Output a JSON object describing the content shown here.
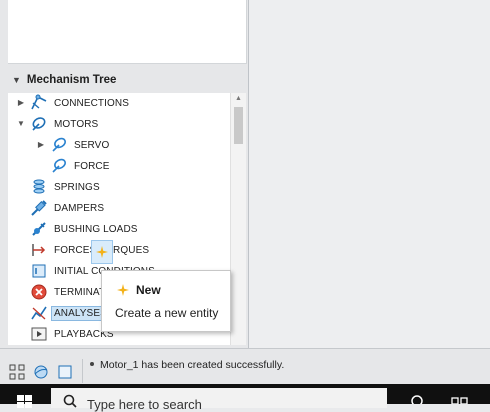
{
  "mechanism_tree": {
    "header": "Mechanism Tree",
    "items": [
      {
        "label": "CONNECTIONS",
        "expander": "collapsed",
        "icon": "connections-icon"
      },
      {
        "label": "MOTORS",
        "expander": "expanded",
        "icon": "motors-icon"
      },
      {
        "label": "SERVO",
        "expander": "collapsed",
        "icon": "servo-motor-icon"
      },
      {
        "label": "FORCE",
        "expander": "none",
        "icon": "force-motor-icon"
      },
      {
        "label": "SPRINGS",
        "expander": "none",
        "icon": "spring-icon"
      },
      {
        "label": "DAMPERS",
        "expander": "none",
        "icon": "damper-icon"
      },
      {
        "label": "BUSHING LOADS",
        "expander": "none",
        "icon": "bushing-load-icon"
      },
      {
        "label": "FORCES/TORQUES",
        "expander": "none",
        "icon": "force-torque-icon"
      },
      {
        "label": "INITIAL CONDITIONS",
        "expander": "none",
        "icon": "initial-conditions-icon"
      },
      {
        "label": "TERMINATION CONDITIONS",
        "expander": "none",
        "icon": "termination-conditions-icon"
      },
      {
        "label": "ANALYSES",
        "expander": "none",
        "icon": "analysis-icon",
        "selected": true
      },
      {
        "label": "PLAYBACKS",
        "expander": "none",
        "icon": "playback-icon"
      }
    ]
  },
  "popup": {
    "title": "New",
    "description": "Create a new entity",
    "icon": "new-entity-sparkle-icon"
  },
  "status_bar": {
    "message": "Motor_1 has been created successfully."
  },
  "taskbar": {
    "search_text": "Type here to search"
  },
  "colors": {
    "selection": "#cde4f7",
    "accent_blue": "#1f6fb5",
    "sparkle": "#f3b21a"
  }
}
